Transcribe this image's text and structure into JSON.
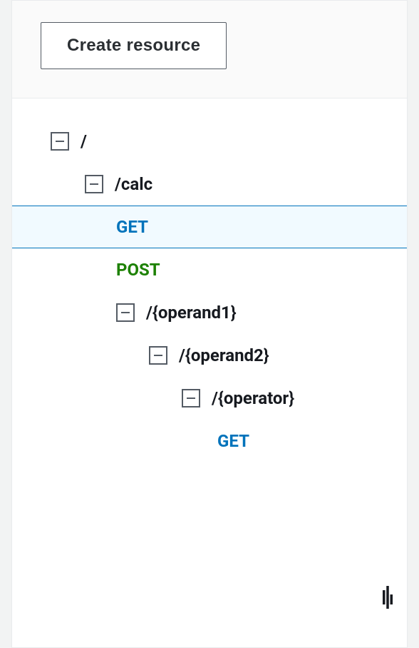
{
  "header": {
    "create_button_label": "Create resource"
  },
  "tree": {
    "root": {
      "label": "/"
    },
    "calc": {
      "label": "/calc"
    },
    "calc_get": {
      "label": "GET"
    },
    "calc_post": {
      "label": "POST"
    },
    "operand1": {
      "label": "/{operand1}"
    },
    "operand2": {
      "label": "/{operand2}"
    },
    "operator": {
      "label": "/{operator}"
    },
    "operator_get": {
      "label": "GET"
    }
  }
}
